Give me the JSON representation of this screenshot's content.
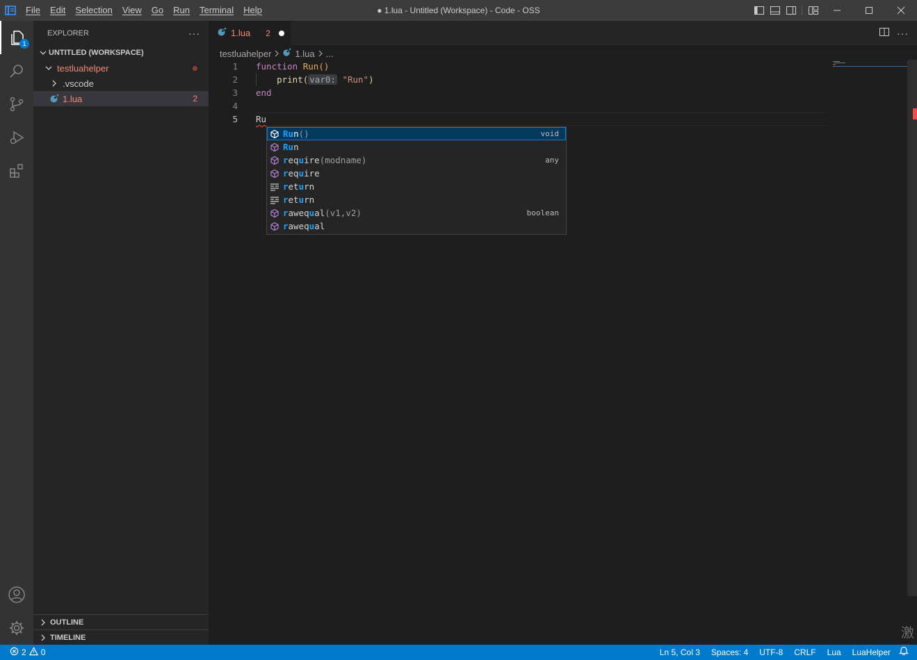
{
  "titlebar": {
    "menu": [
      "File",
      "Edit",
      "Selection",
      "View",
      "Go",
      "Run",
      "Terminal",
      "Help"
    ],
    "window_title": "● 1.lua - Untitled (Workspace) - Code - OSS"
  },
  "activitybar": {
    "explorer_badge": "1"
  },
  "sidebar": {
    "title": "EXPLORER",
    "more": "···",
    "workspace": "UNTITLED (WORKSPACE)",
    "folder": "testluahelper",
    "subfolder": ".vscode",
    "file": "1.lua",
    "file_problems": "2",
    "outline": "OUTLINE",
    "timeline": "TIMELINE"
  },
  "tab": {
    "label": "1.lua",
    "problems": "2"
  },
  "breadcrumb": {
    "folder": "testluahelper",
    "file": "1.lua",
    "more": "..."
  },
  "editor": {
    "line_numbers": [
      "1",
      "2",
      "3",
      "4",
      "5"
    ],
    "l1_kw": "function",
    "l1_fn": "Run()",
    "l2_indent": "    ",
    "l2_fn": "print(",
    "l2_hint": "var0:",
    "l2_str": "\"Run\"",
    "l2_close": ")",
    "l3_kw": "end",
    "l5_text": "Ru"
  },
  "suggest": {
    "items": [
      {
        "hl": "Ru",
        "rest": "n",
        "sig": "()",
        "detail": "void",
        "kind": "method"
      },
      {
        "hl": "Ru",
        "rest": "n",
        "sig": "",
        "detail": "",
        "kind": "method"
      },
      {
        "hl": "r",
        "rest": "eq",
        "hl2": "u",
        "rest2": "ire",
        "sig": "(modname)",
        "detail": "any",
        "kind": "method"
      },
      {
        "hl": "r",
        "rest": "eq",
        "hl2": "u",
        "rest2": "ire",
        "sig": "",
        "detail": "",
        "kind": "method"
      },
      {
        "hl": "r",
        "rest": "et",
        "hl2": "u",
        "rest2": "rn",
        "sig": "",
        "detail": "",
        "kind": "keyword"
      },
      {
        "hl": "r",
        "rest": "et",
        "hl2": "u",
        "rest2": "rn",
        "sig": "",
        "detail": "",
        "kind": "keyword"
      },
      {
        "hl": "r",
        "rest": "aweq",
        "hl2": "u",
        "rest2": "al",
        "sig": "(v1,v2)",
        "detail": "boolean",
        "kind": "method"
      },
      {
        "hl": "r",
        "rest": "aweq",
        "hl2": "u",
        "rest2": "al",
        "sig": "",
        "detail": "",
        "kind": "method"
      }
    ]
  },
  "statusbar": {
    "errors": "2",
    "warnings": "0",
    "position": "Ln 5, Col 3",
    "spaces": "Spaces: 4",
    "encoding": "UTF-8",
    "eol": "CRLF",
    "language": "Lua",
    "extension": "LuaHelper"
  },
  "colors": {
    "accent": "#007acc",
    "error": "#f48771",
    "suggest_highlight": "#18a3ff"
  }
}
